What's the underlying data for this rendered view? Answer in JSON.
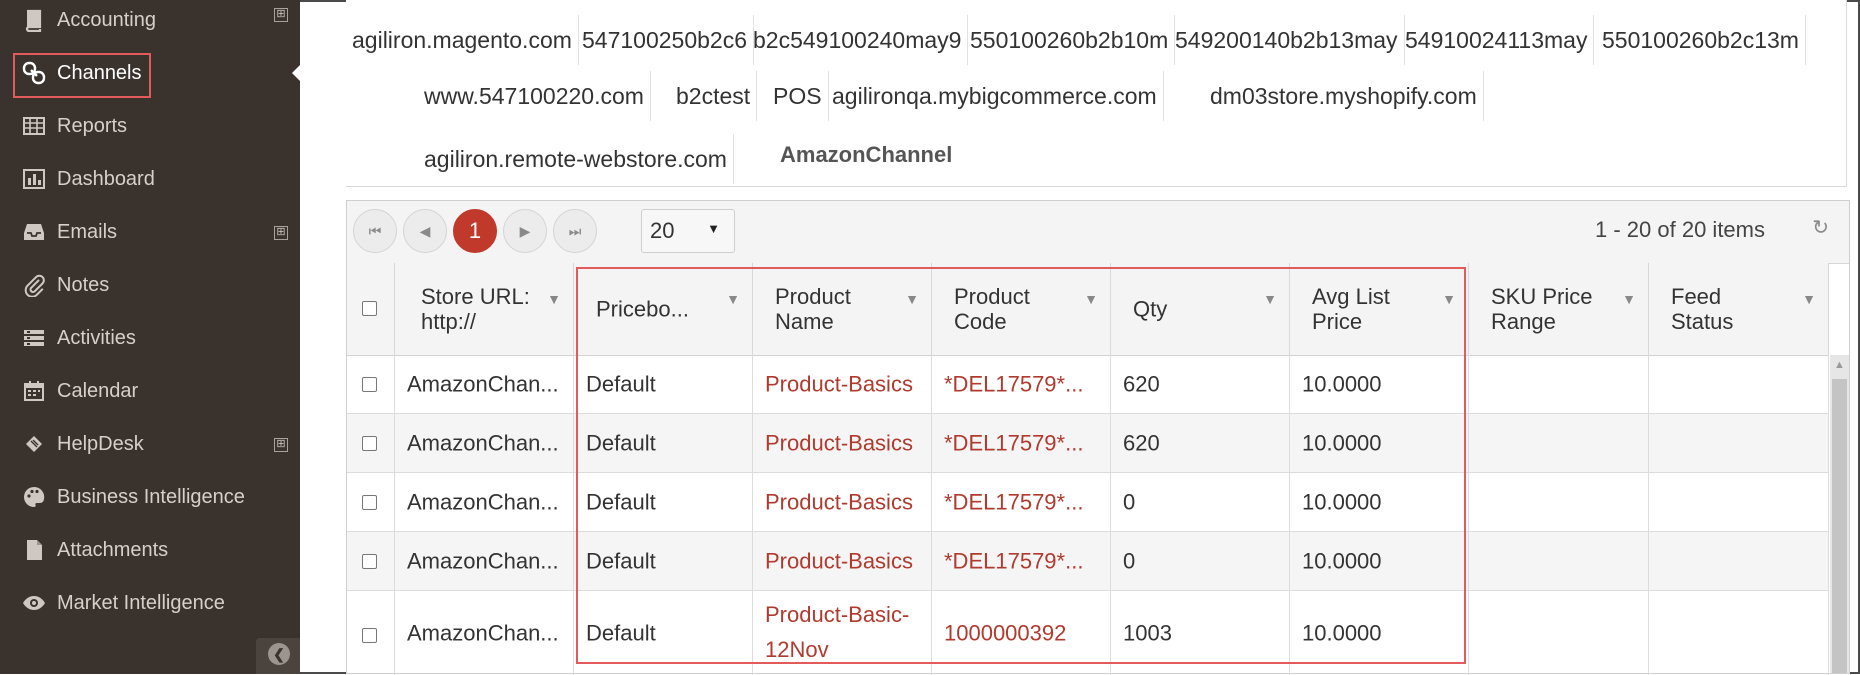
{
  "sidebar": {
    "items": [
      {
        "label": "Accounting",
        "icon": "book-icon",
        "expandable": true
      },
      {
        "label": "Channels",
        "icon": "link-icon",
        "expandable": false,
        "active": true
      },
      {
        "label": "Reports",
        "icon": "table-icon",
        "expandable": false
      },
      {
        "label": "Dashboard",
        "icon": "bar-chart-icon",
        "expandable": false
      },
      {
        "label": "Emails",
        "icon": "inbox-icon",
        "expandable": true
      },
      {
        "label": "Notes",
        "icon": "paperclip-icon",
        "expandable": false
      },
      {
        "label": "Activities",
        "icon": "list-icon",
        "expandable": false
      },
      {
        "label": "Calendar",
        "icon": "calendar-icon",
        "expandable": false
      },
      {
        "label": "HelpDesk",
        "icon": "ticket-icon",
        "expandable": true
      },
      {
        "label": "Business Intelligence",
        "icon": "palette-icon",
        "expandable": false
      },
      {
        "label": "Attachments",
        "icon": "file-icon",
        "expandable": false
      },
      {
        "label": "Market Intelligence",
        "icon": "eye-icon",
        "expandable": false
      }
    ],
    "expand_symbol": "⊞",
    "collapse_symbol": "❮"
  },
  "tabs": {
    "row1": [
      "agiliron.magento.com",
      "547100250b2c6",
      "b2c549100240may9",
      "550100260b2b10m",
      "549200140b2b13may",
      "54910024113may",
      "550100260b2c13m"
    ],
    "row2": [
      "www.547100220.com",
      "b2ctest",
      "POS",
      "agilironqa.mybigcommerce.com",
      "dm03store.myshopify.com"
    ],
    "row3": [
      "agiliron.remote-webstore.com",
      "AmazonChannel"
    ],
    "active": "AmazonChannel"
  },
  "pager": {
    "first": "⏮",
    "prev": "◀",
    "current_page": "1",
    "next": "▶",
    "last": "⏭",
    "page_size": "20",
    "info": "1 - 20 of 20 items",
    "refresh": "↻"
  },
  "columns": [
    "Store URL: http://",
    "Pricebo...",
    "Product Name",
    "Product Code",
    "Qty",
    "Avg List Price",
    "SKU Price Range",
    "Feed Status"
  ],
  "rows": [
    {
      "store": "AmazonChan...",
      "pricebook": "Default",
      "product_name": [
        "Product-Basics"
      ],
      "product_code": "*DEL17579*...",
      "qty": "620",
      "avg_price": "10.0000",
      "sku_range": "",
      "feed_status": ""
    },
    {
      "store": "AmazonChan...",
      "pricebook": "Default",
      "product_name": [
        "Product-Basics"
      ],
      "product_code": "*DEL17579*...",
      "qty": "620",
      "avg_price": "10.0000",
      "sku_range": "",
      "feed_status": ""
    },
    {
      "store": "AmazonChan...",
      "pricebook": "Default",
      "product_name": [
        "Product-Basics"
      ],
      "product_code": "*DEL17579*...",
      "qty": "0",
      "avg_price": "10.0000",
      "sku_range": "",
      "feed_status": ""
    },
    {
      "store": "AmazonChan...",
      "pricebook": "Default",
      "product_name": [
        "Product-Basics"
      ],
      "product_code": "*DEL17579*...",
      "qty": "0",
      "avg_price": "10.0000",
      "sku_range": "",
      "feed_status": ""
    },
    {
      "store": "AmazonChan...",
      "pricebook": "Default",
      "product_name": [
        "Product-Basic-",
        "12Nov"
      ],
      "product_code": "1000000392",
      "qty": "1003",
      "avg_price": "10.0000",
      "sku_range": "",
      "feed_status": ""
    }
  ],
  "colors": {
    "sidebar_bg": "#3a322d",
    "accent": "#c0392b",
    "link": "#b03a2e",
    "highlight": "#e25a5a"
  }
}
